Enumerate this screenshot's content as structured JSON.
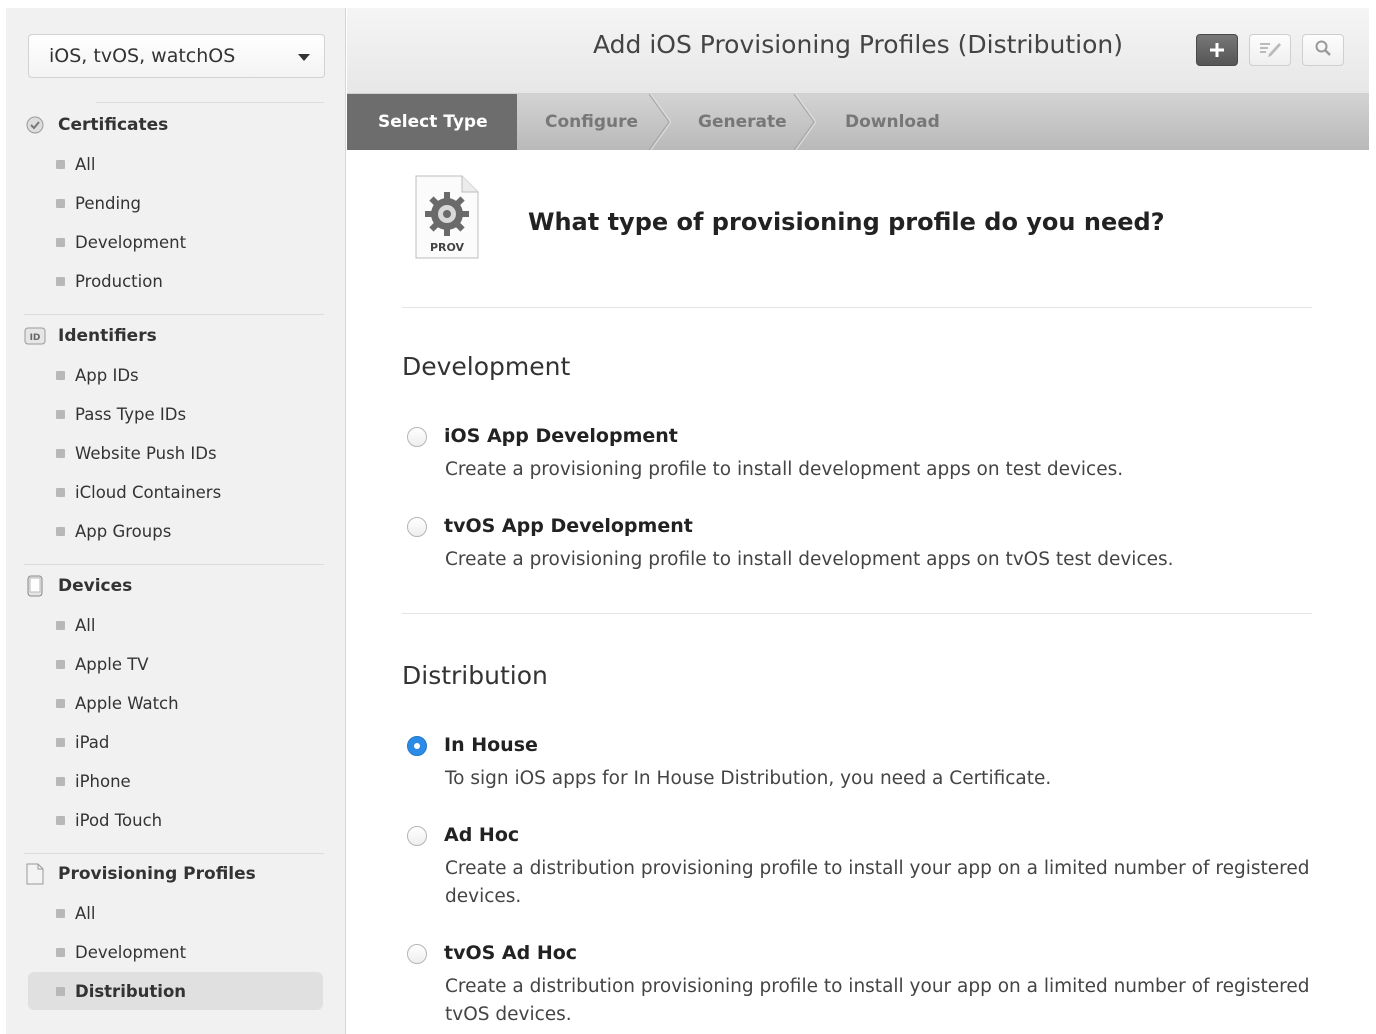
{
  "platform_select": {
    "value": "iOS, tvOS, watchOS"
  },
  "sidebar": {
    "certificates": {
      "label": "Certificates",
      "items": [
        "All",
        "Pending",
        "Development",
        "Production"
      ]
    },
    "identifiers": {
      "label": "Identifiers",
      "badge": "ID",
      "items": [
        "App IDs",
        "Pass Type IDs",
        "Website Push IDs",
        "iCloud Containers",
        "App Groups"
      ]
    },
    "devices": {
      "label": "Devices",
      "items": [
        "All",
        "Apple TV",
        "Apple Watch",
        "iPad",
        "iPhone",
        "iPod Touch"
      ]
    },
    "profiles": {
      "label": "Provisioning Profiles",
      "items": [
        "All",
        "Development",
        "Distribution"
      ],
      "selected": "Distribution"
    }
  },
  "header": {
    "title": "Add iOS Provisioning Profiles (Distribution)",
    "add_icon": "plus-icon",
    "edit_icon": "edit-icon",
    "search_icon": "search-icon"
  },
  "steps": [
    "Select Type",
    "Configure",
    "Generate",
    "Download"
  ],
  "main": {
    "prov_icon_label": "PROV",
    "question": "What type of provisioning profile do you need?",
    "development": {
      "title": "Development",
      "options": [
        {
          "title": "iOS App Development",
          "desc": "Create a provisioning profile to install development apps on test devices.",
          "checked": false
        },
        {
          "title": "tvOS App Development",
          "desc": "Create a provisioning profile to install development apps on tvOS test devices.",
          "checked": false
        }
      ]
    },
    "distribution": {
      "title": "Distribution",
      "options": [
        {
          "title": "In House",
          "desc": "To sign iOS apps for In House Distribution, you need a Certificate.",
          "checked": true
        },
        {
          "title": "Ad Hoc",
          "desc": "Create a distribution provisioning profile to install your app on a limited number of registered devices.",
          "checked": false
        },
        {
          "title": "tvOS Ad Hoc",
          "desc": "Create a distribution provisioning profile to install your app on a limited number of registered tvOS devices.",
          "checked": false
        }
      ]
    }
  },
  "colors": {
    "accent": "#2b8be6",
    "active_step": "#6d6d6d"
  }
}
